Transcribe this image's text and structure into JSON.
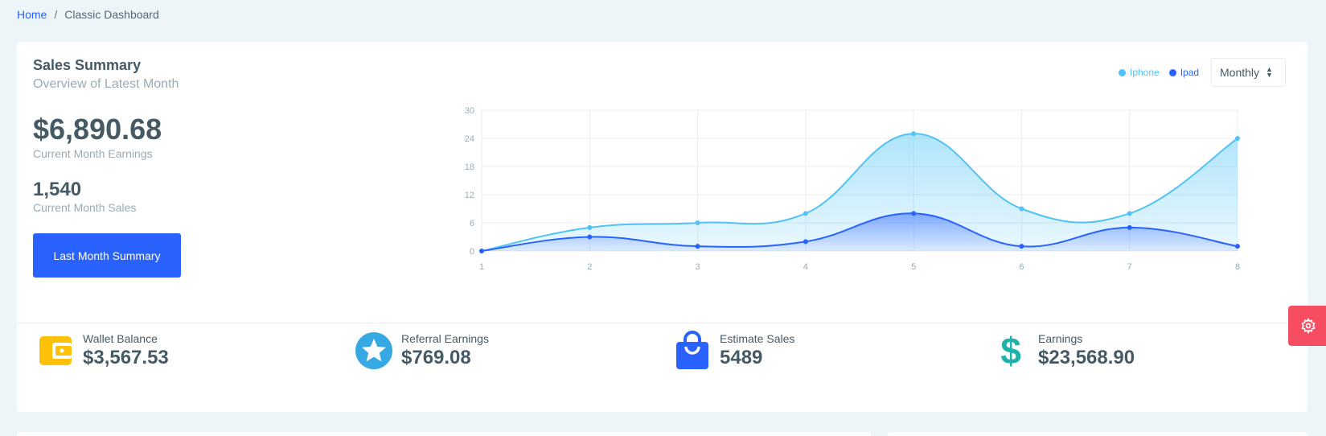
{
  "breadcrumb": {
    "home": "Home",
    "separator": "/",
    "current": "Classic Dashboard"
  },
  "summary": {
    "title": "Sales Summary",
    "subtitle": "Overview of Latest Month",
    "earnings_value": "$6,890.68",
    "earnings_label": "Current Month Earnings",
    "sales_value": "1,540",
    "sales_label": "Current Month Sales",
    "button_label": "Last Month Summary"
  },
  "legend": [
    {
      "label": "Iphone",
      "color": "#4fc3f7"
    },
    {
      "label": "Ipad",
      "color": "#2962ff"
    }
  ],
  "period_select": {
    "value": "Monthly"
  },
  "chart_data": {
    "type": "area",
    "x": [
      1,
      2,
      3,
      4,
      5,
      6,
      7,
      8
    ],
    "series": [
      {
        "name": "Iphone",
        "values": [
          0,
          5,
          6,
          8,
          25,
          9,
          8,
          24
        ],
        "color": "#4fc3f7"
      },
      {
        "name": "Ipad",
        "values": [
          0,
          3,
          1,
          2,
          8,
          1,
          5,
          1
        ],
        "color": "#2962ff"
      }
    ],
    "yticks": [
      0,
      6,
      12,
      18,
      24,
      30
    ],
    "ylim": [
      0,
      30
    ],
    "xlim": [
      1,
      8
    ],
    "grid": true,
    "legend_position": "top-right"
  },
  "stats": [
    {
      "label": "Wallet Balance",
      "value": "$3,567.53",
      "icon": "wallet-icon",
      "color": "#ffc107"
    },
    {
      "label": "Referral Earnings",
      "value": "$769.08",
      "icon": "star-icon",
      "color": "#36bea6"
    },
    {
      "label": "Estimate Sales",
      "value": "5489",
      "icon": "shopping-bag-icon",
      "color": "#2962ff"
    },
    {
      "label": "Earnings",
      "value": "$23,568.90",
      "icon": "dollar-icon",
      "color": "#20aee3"
    }
  ]
}
